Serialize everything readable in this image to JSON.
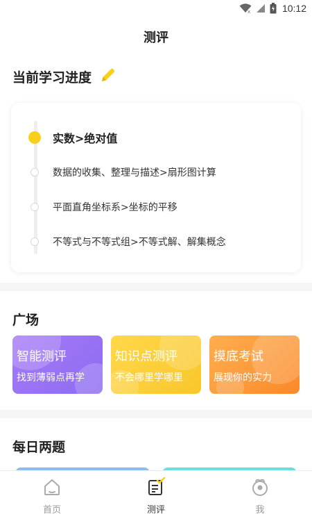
{
  "status_bar": {
    "time": "10:12"
  },
  "header": {
    "title": "测评"
  },
  "progress": {
    "heading": "当前学习进度",
    "items": [
      {
        "label": "实数>绝对值",
        "active": true
      },
      {
        "label": "数据的收集、整理与描述>扇形图计算",
        "active": false
      },
      {
        "label": "平面直角坐标系>坐标的平移",
        "active": false
      },
      {
        "label": "不等式与不等式组>不等式解、解集概念",
        "active": false
      }
    ]
  },
  "plaza": {
    "heading": "广场",
    "cards": [
      {
        "title": "智能测评",
        "subtitle": "找到薄弱点再学",
        "color": "#9a73f4"
      },
      {
        "title": "知识点测评",
        "subtitle": "不会哪里学哪里",
        "color": "#fbcf35"
      },
      {
        "title": "摸底考试",
        "subtitle": "展现你的实力",
        "color": "#fb9a3b"
      }
    ]
  },
  "daily": {
    "heading": "每日两题"
  },
  "bottom_nav": {
    "items": [
      {
        "label": "首页",
        "icon": "home-icon",
        "active": false
      },
      {
        "label": "测评",
        "icon": "assessment-icon",
        "active": true
      },
      {
        "label": "我",
        "icon": "profile-icon",
        "active": false
      }
    ]
  },
  "colors": {
    "accent": "#f9cf1d",
    "divider": "#f4f5f7"
  }
}
